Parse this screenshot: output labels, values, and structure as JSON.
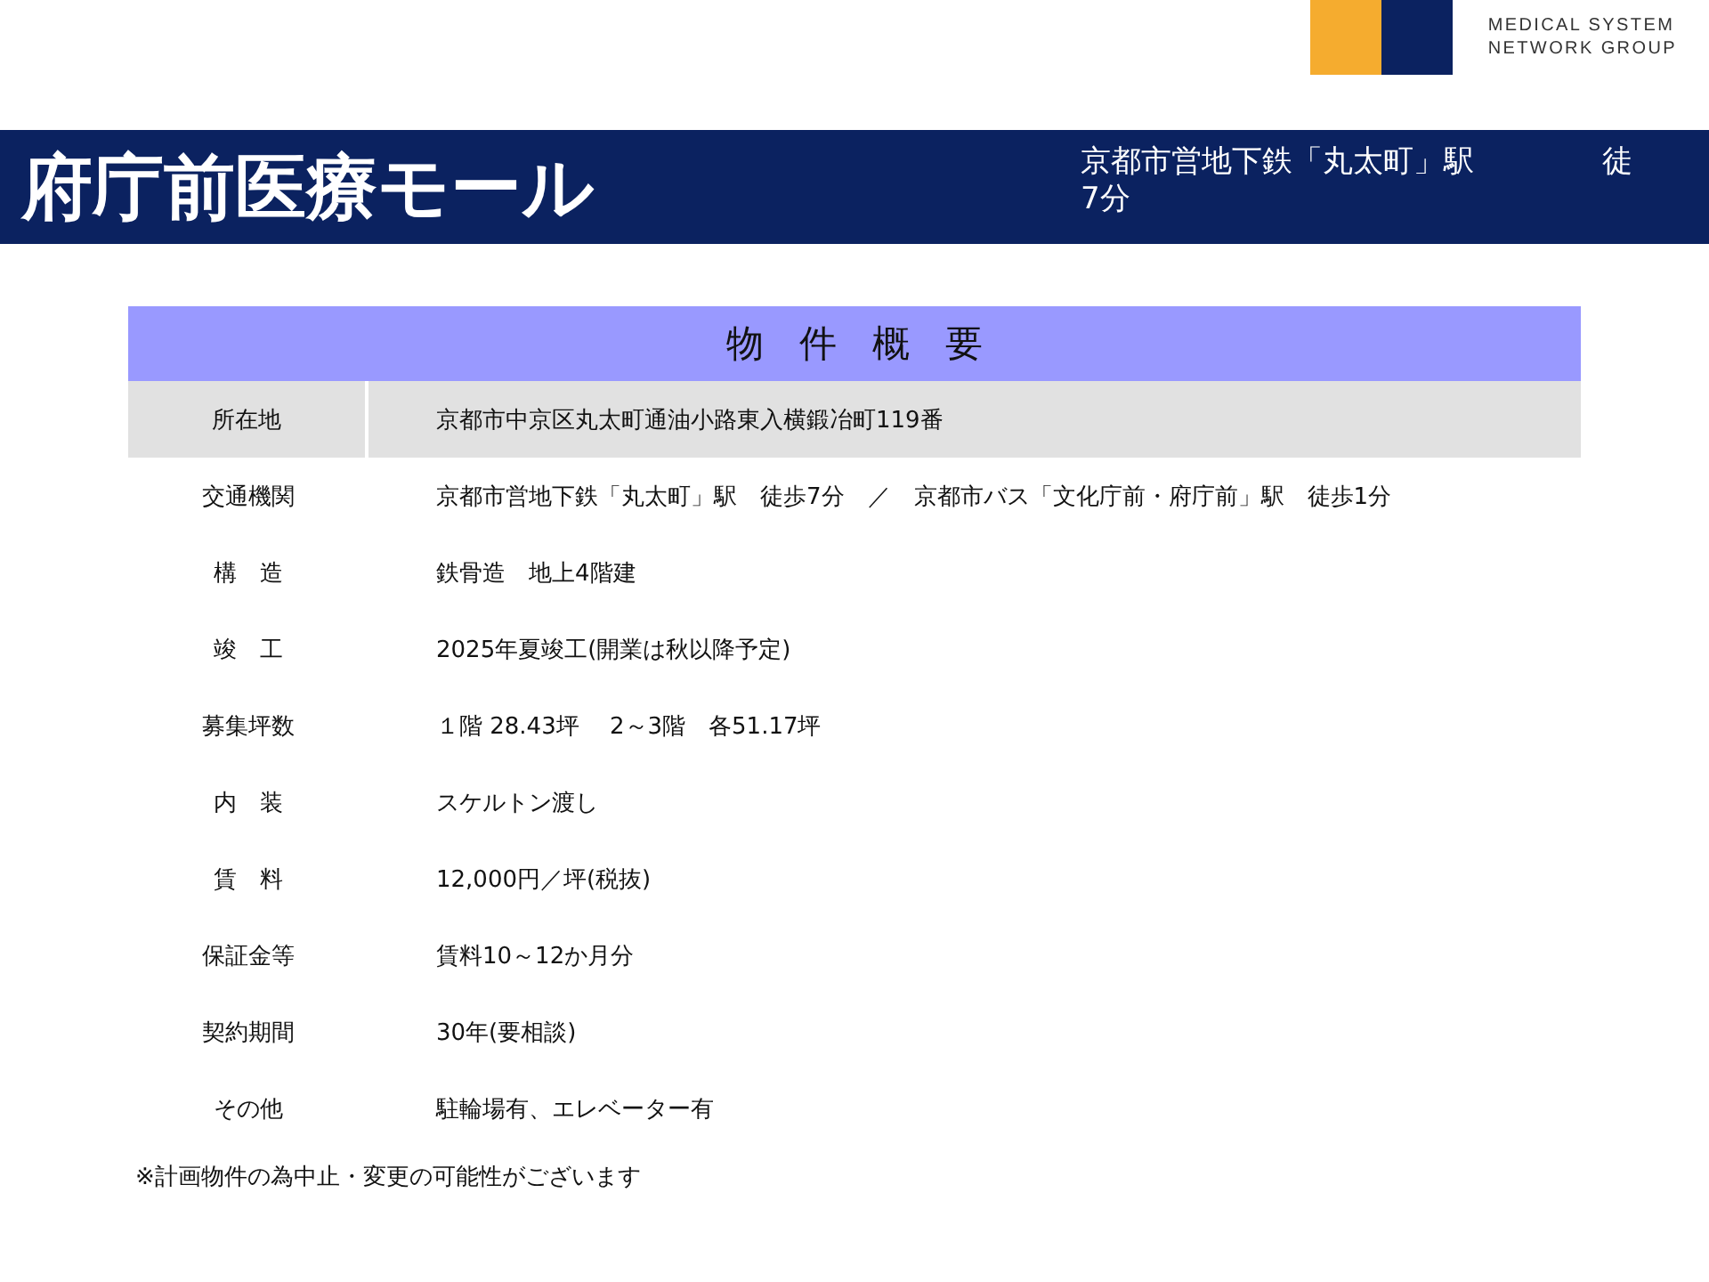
{
  "logo": {
    "lines": [
      "MEDICAL SYSTEM",
      "NETWORK GROUP"
    ]
  },
  "header": {
    "title": "府庁前医療モール",
    "access_lines": [
      [
        "京都市営地下鉄「丸太町」駅",
        "徒"
      ],
      [
        "7分"
      ]
    ]
  },
  "table": {
    "title": "物件概要",
    "rows": [
      {
        "kind": "shaded",
        "label": "所在地",
        "value": "京都市中京区丸太町通油小路東入横鍛冶町119番"
      },
      {
        "kind": "plain",
        "label": "交通機関",
        "value": "京都市営地下鉄「丸太町」駅　徒歩7分　／　京都市バス「文化庁前・府庁前」駅　徒歩1分"
      },
      {
        "kind": "plain",
        "label": "構　造",
        "value": "鉄骨造　地上4階建"
      },
      {
        "kind": "plain",
        "label": "竣　工",
        "value": "2025年夏竣工(開業は秋以降予定)"
      },
      {
        "kind": "plain",
        "label": "募集坪数",
        "value": "１階 28.43坪　 2～3階　各51.17坪"
      },
      {
        "kind": "plain",
        "label": "内　装",
        "value": "スケルトン渡し"
      },
      {
        "kind": "plain",
        "label": "賃　料",
        "value": "12,000円／坪(税抜)"
      },
      {
        "kind": "plain",
        "label": "保証金等",
        "value": "賃料10～12か月分"
      },
      {
        "kind": "plain",
        "label": "契約期間",
        "value": "30年(要相談)"
      },
      {
        "kind": "plain",
        "label": "その他",
        "value": "駐輪場有、エレベーター有"
      }
    ]
  },
  "footnote": "※計画物件の為中止・変更の可能性がございます"
}
